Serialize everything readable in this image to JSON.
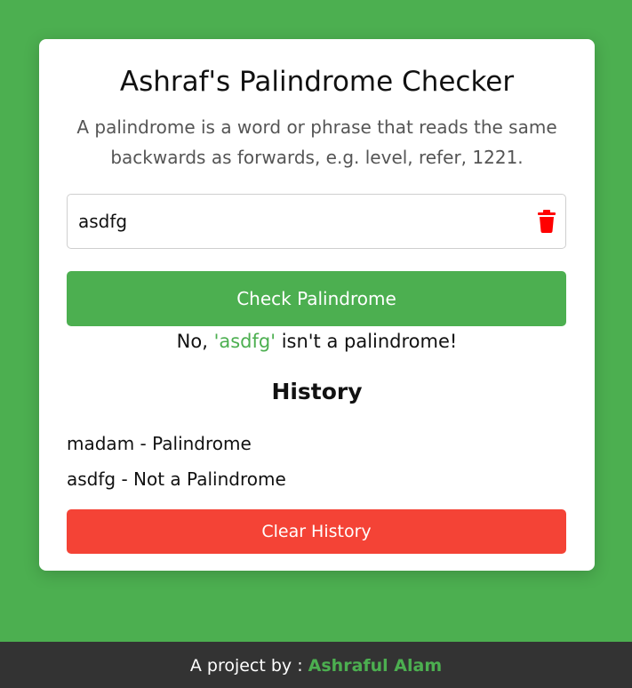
{
  "card": {
    "title": "Ashraf's Palindrome Checker",
    "description": "A palindrome is a word or phrase that reads the same backwards as forwards, e.g. level, refer, 1221."
  },
  "input": {
    "value": "asdfg",
    "placeholder": ""
  },
  "icons": {
    "clear_input": "trash-icon"
  },
  "check_button": {
    "label": "Check Palindrome"
  },
  "result": {
    "prefix": "No, ",
    "word": "'asdfg'",
    "suffix": " isn't a palindrome!"
  },
  "history": {
    "title": "History",
    "items": [
      "madam - Palindrome",
      "asdfg - Not a Palindrome"
    ],
    "clear_label": "Clear History"
  },
  "footer": {
    "prefix": "A project by : ",
    "author": "Ashraful Alam"
  },
  "colors": {
    "background": "#4caf50",
    "accent": "#4caf50",
    "danger": "#f44336",
    "trash_icon": "#ff0000",
    "footer_bg": "#333333"
  }
}
